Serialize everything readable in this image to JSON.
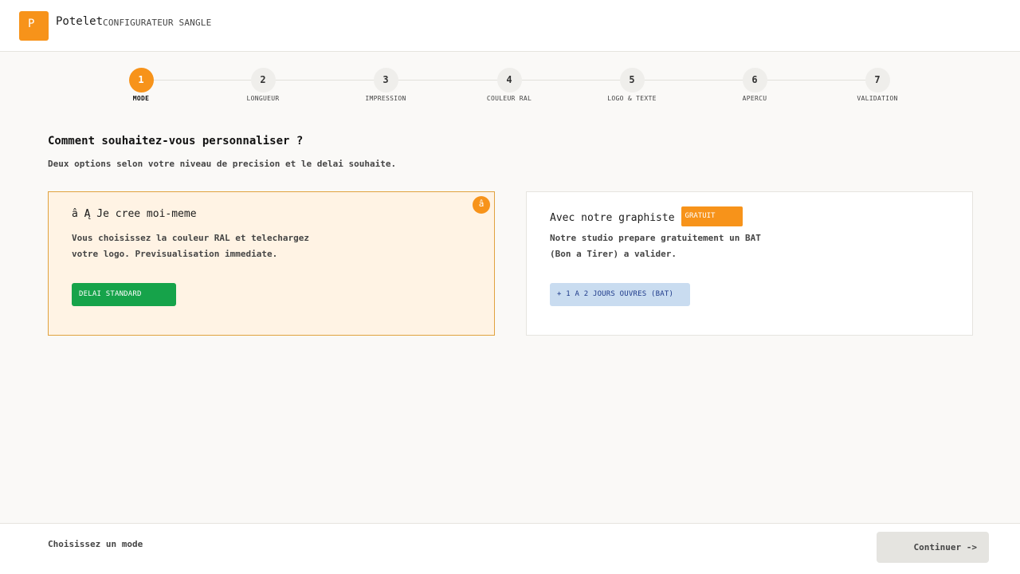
{
  "header": {
    "logo_letter": "P",
    "brand": "Potelet",
    "subtitle": "CONFIGURATEUR SANGLE"
  },
  "steps": [
    {
      "number": "1",
      "label": "MODE",
      "active": true
    },
    {
      "number": "2",
      "label": "LONGUEUR",
      "active": false
    },
    {
      "number": "3",
      "label": "IMPRESSION",
      "active": false
    },
    {
      "number": "4",
      "label": "COULEUR RAL",
      "active": false
    },
    {
      "number": "5",
      "label": "LOGO & TEXTE",
      "active": false
    },
    {
      "number": "6",
      "label": "APERCU",
      "active": false
    },
    {
      "number": "7",
      "label": "VALIDATION",
      "active": false
    }
  ],
  "main": {
    "title": "Comment souhaitez-vous personnaliser ?",
    "subtitle": "Deux options selon votre niveau de precision et le delai souhaite."
  },
  "options": [
    {
      "title": "â Ą Je cree moi-meme",
      "description_line1": "Vous choisissez la couleur RAL et telechargez",
      "description_line2": "votre logo. Previsualisation immediate.",
      "tag": "DELAI STANDARD",
      "check": "â",
      "selected": true
    },
    {
      "title": "Avec notre graphiste",
      "badge": "GRATUIT",
      "description_line1": "Notre studio prepare gratuitement un BAT",
      "description_line2": "(Bon a Tirer) a valider.",
      "tag": "+ 1 A 2 JOURS OUVRES (BAT)",
      "selected": false
    }
  ],
  "footer": {
    "status": "Choisissez un mode",
    "continue_label": "Continuer ->"
  },
  "colors": {
    "accent": "#f7931a",
    "green": "#16a34a",
    "blue_tag_bg": "#c9dcf0"
  }
}
